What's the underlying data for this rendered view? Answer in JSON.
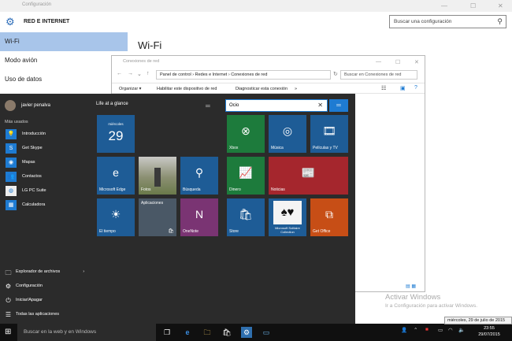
{
  "settings": {
    "window_title": "Configuración",
    "header_title": "RED E INTERNET",
    "search_placeholder": "Buscar una configuración",
    "nav": [
      "Wi-Fi",
      "Modo avión",
      "Uso de datos"
    ],
    "page_title": "Wi-Fi"
  },
  "control_panel": {
    "title": "Conexiones de red",
    "breadcrumb": [
      "Panel de control",
      "Redes e Internet",
      "Conexiones de red"
    ],
    "search_placeholder": "Buscar en Conexiones de red",
    "toolbar": [
      "Organizar ▾",
      "Habilitar este dispositivo de red",
      "Diagnosticar esta conexión",
      "»"
    ]
  },
  "watermark": {
    "line1": "Activar Windows",
    "line2": "Ir a Configuración para activar Windows."
  },
  "start": {
    "user": "javier penalva",
    "most_used_label": "Más usados",
    "most_used": [
      "Introducción",
      "Get Skype",
      "Mapas",
      "Contactos",
      "LG PC Suite",
      "Calculadora"
    ],
    "system": [
      "Explorador de archivos",
      "Configuración",
      "Iniciar/Apagar",
      "Todas las aplicaciones"
    ],
    "group_title": "Life at a glance",
    "group_search_value": "Ocio",
    "tiles": {
      "calendar_day": "miércoles",
      "calendar_date": "29",
      "edge": "Microsoft Edge",
      "photos": "Fotos",
      "search": "Búsqueda",
      "weather": "El tiempo",
      "apps": "Aplicaciones",
      "onenote": "OneNote",
      "xbox": "Xbox",
      "music": "Música",
      "movies": "Películas y TV",
      "money": "Dinero",
      "news": "Noticias",
      "store": "Store",
      "solitaire": "Microsoft Solitaire Collection",
      "office": "Get Office"
    }
  },
  "taskbar": {
    "search_placeholder": "Buscar en la web y en Windows",
    "tooltip": "miércoles, 29 de julio de 2015",
    "time": "23:55",
    "date": "29/07/2015"
  },
  "colors": {
    "accent": "#1e7bd2",
    "start_bg": "#2b2b2b",
    "taskbar_bg": "#101010",
    "tile_blue": "#1e5c96",
    "tile_green": "#1d7b3c",
    "tile_red": "#a5262d"
  }
}
